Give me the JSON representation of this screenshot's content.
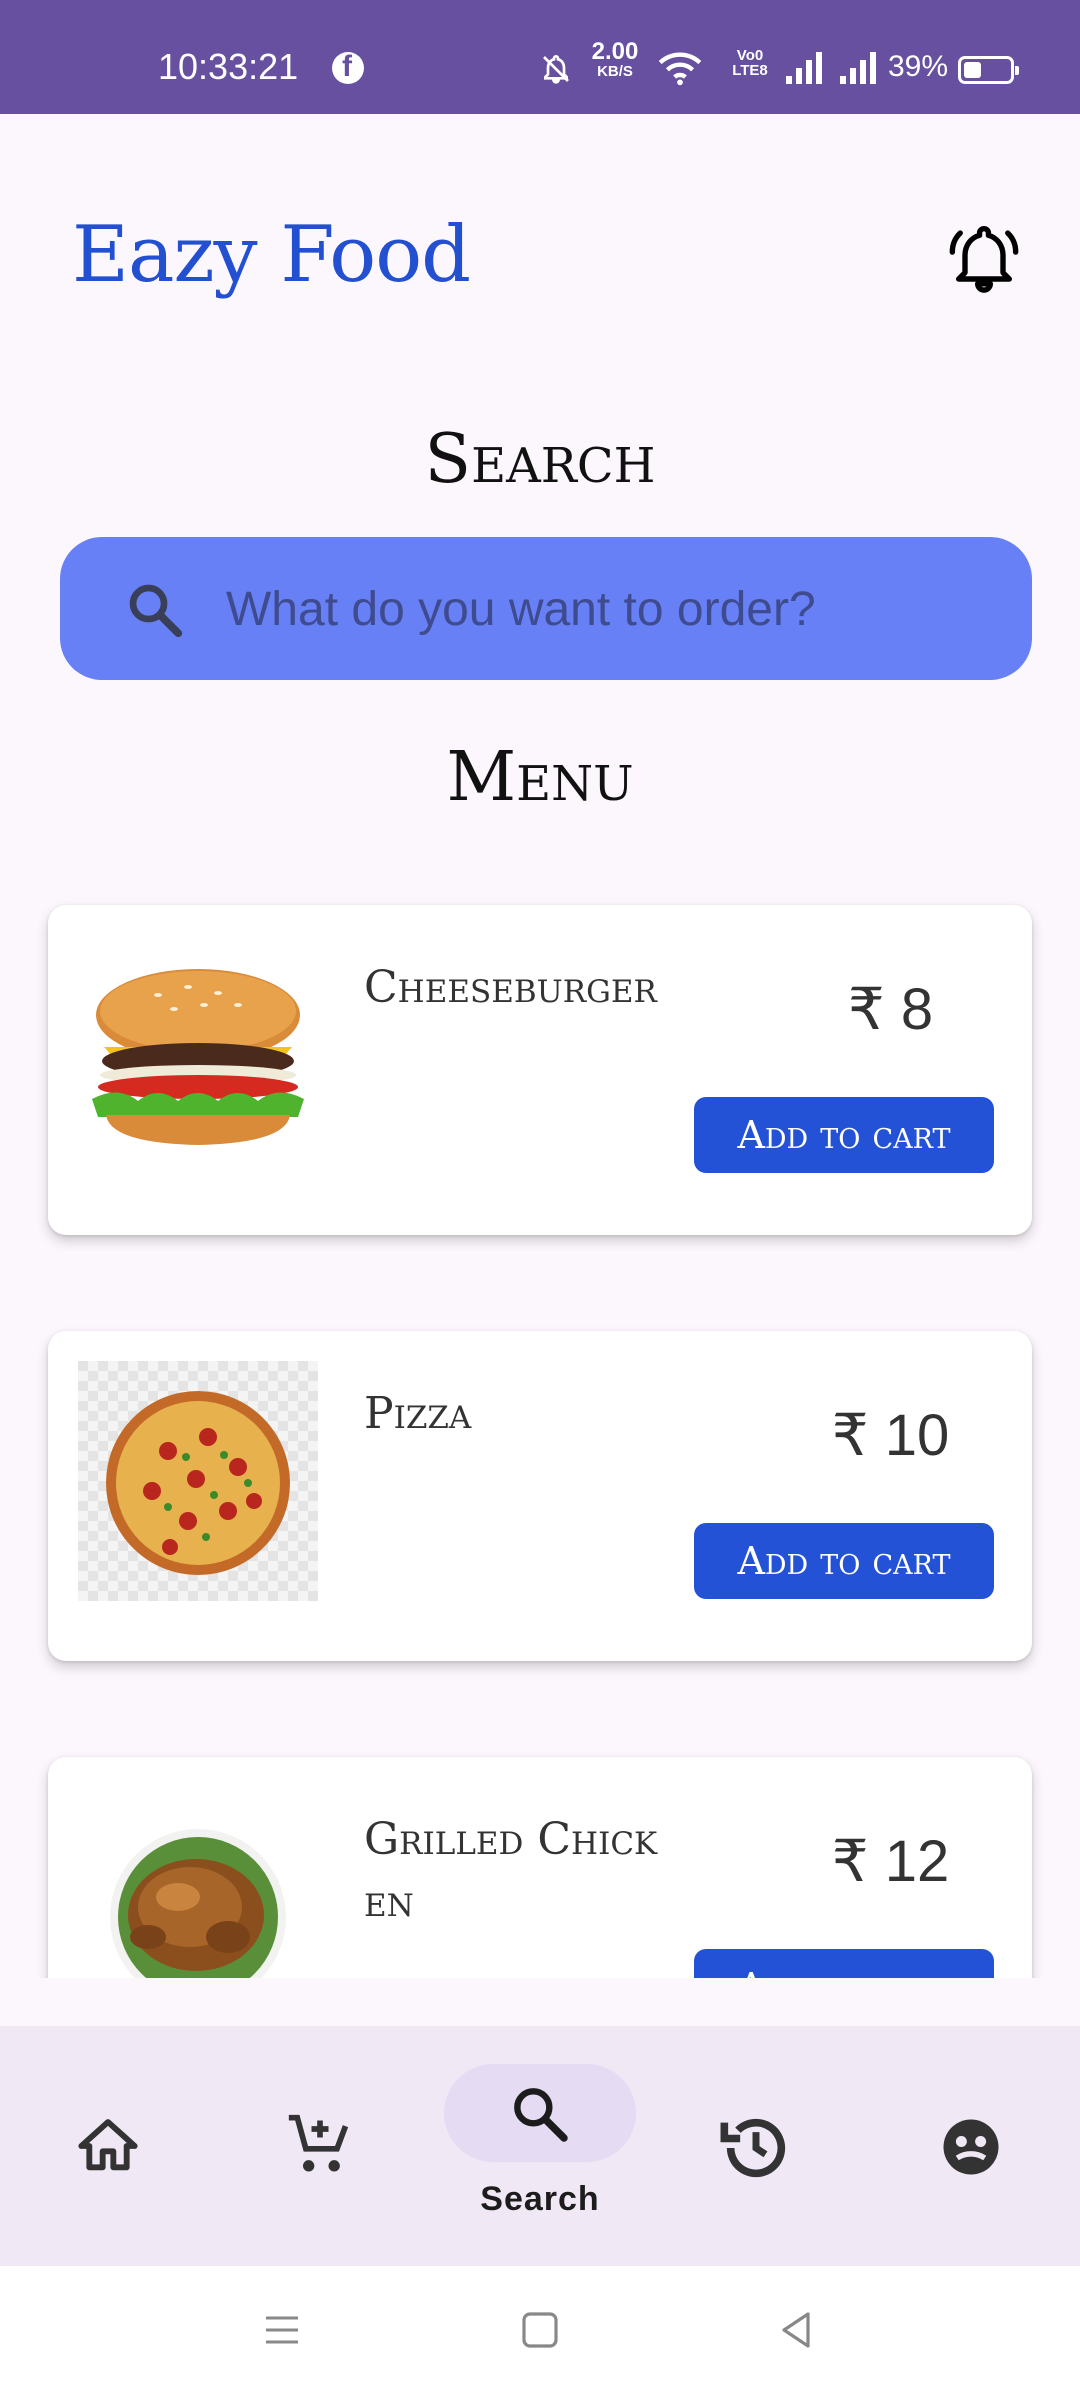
{
  "status_bar": {
    "time": "10:33:21",
    "net_speed_value": "2.00",
    "net_speed_unit": "KB/S",
    "volte_top": "Vo0",
    "volte_bottom": "LTE8",
    "battery_percent": "39%",
    "battery_level": 0.39,
    "icons": [
      "facebook-icon",
      "mute-bell-icon",
      "wifi-icon",
      "signal-icon",
      "signal-icon",
      "battery-icon"
    ]
  },
  "header": {
    "app_title": "Eazy Food",
    "notification_icon": "bell-icon"
  },
  "search": {
    "section_title": "Search",
    "placeholder": "What do you want to order?",
    "icon": "search-icon"
  },
  "menu": {
    "section_title": "Menu",
    "items": [
      {
        "name": "Cheeseburger",
        "price": "₹ 8",
        "button": "Add to cart",
        "image": "burger"
      },
      {
        "name": "Pizza",
        "price": "₹ 10",
        "button": "Add to cart",
        "image": "pizza"
      },
      {
        "name": "Grilled Chicken",
        "price": "₹ 12",
        "button": "Add to cart",
        "image": "chicken"
      }
    ]
  },
  "bottom_nav": {
    "active": "search",
    "items": [
      {
        "id": "home",
        "icon": "home-icon"
      },
      {
        "id": "cart",
        "icon": "cart-icon"
      },
      {
        "id": "search",
        "icon": "search-icon",
        "label": "Search"
      },
      {
        "id": "history",
        "icon": "history-icon"
      },
      {
        "id": "profile",
        "icon": "face-icon"
      }
    ]
  },
  "system_nav": {
    "icons": [
      "menu-icon",
      "home-square-icon",
      "back-triangle-icon"
    ]
  },
  "colors": {
    "status_bar": "#66509f",
    "title_blue": "#2250d0",
    "search_bar": "#6780f5",
    "button_blue": "#2452d6",
    "background": "#fcf6fd",
    "nav_background": "#f1e8f6",
    "nav_pill": "#e5dbf3"
  }
}
